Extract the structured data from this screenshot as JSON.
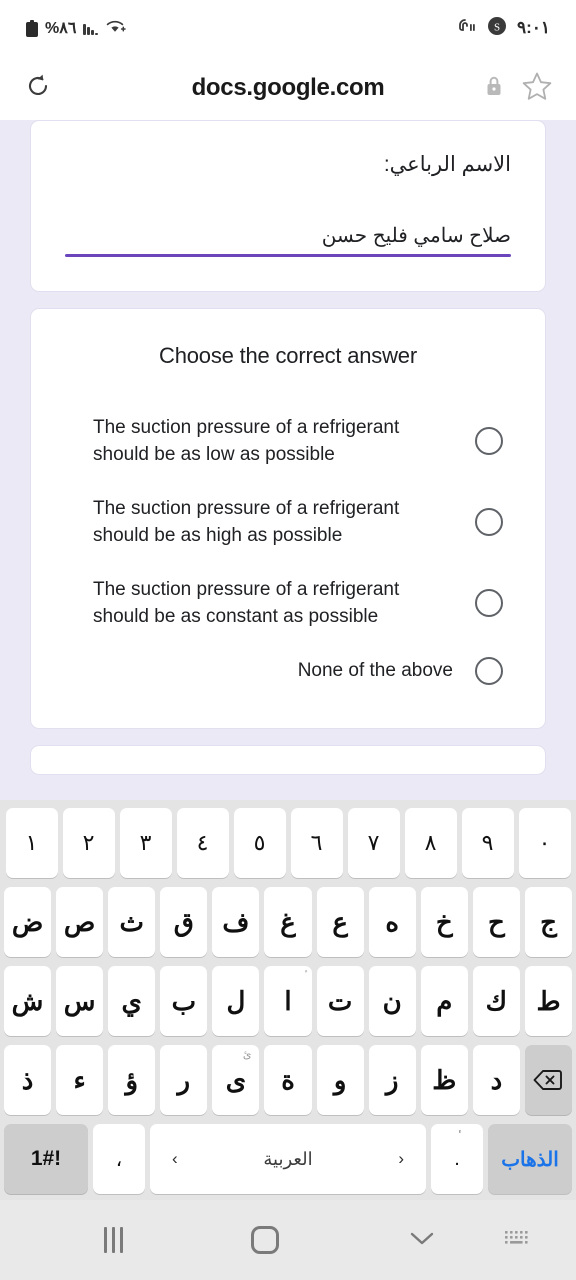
{
  "status_bar": {
    "battery_percent": "%٨٦",
    "battery_icon": "battery-icon",
    "signal_icon": "cellular-signal-icon",
    "wifi_icon": "wifi-icon",
    "vibrate_icon": "vibrate-icon",
    "app_icon": "app-badge-icon",
    "time": "٩:٠١"
  },
  "browser_bar": {
    "reload_icon": "reload-icon",
    "url": "docs.google.com",
    "lock_icon": "lock-icon",
    "bookmark_icon": "star-outline-icon"
  },
  "form": {
    "name_question": {
      "label": "الاسم الرباعي:",
      "answer": "صلاح سامي فليح حسن",
      "underline_color": "#6b45bc"
    },
    "mc_question": {
      "title": "Choose the correct answer",
      "options": [
        "The suction pressure of a refrigerant should be as low as possible",
        "The suction pressure of a refrigerant should be as high as possible",
        "The suction pressure of a refrigerant should be as constant as possible",
        "None of the above"
      ],
      "selected_index": -1
    },
    "error_badge_icon": "error-exclamation-icon"
  },
  "keyboard": {
    "language": "العربية",
    "rows": {
      "numbers": [
        "١",
        "٢",
        "٣",
        "٤",
        "٥",
        "٦",
        "٧",
        "٨",
        "٩",
        "٠"
      ],
      "row1": [
        "ض",
        "ص",
        "ث",
        "ق",
        "ف",
        "غ",
        "ع",
        "ه",
        "خ",
        "ح",
        "ج"
      ],
      "row2": [
        "ش",
        "س",
        "ي",
        "ب",
        "ل",
        "ا",
        "ت",
        "ن",
        "م",
        "ك",
        "ط"
      ],
      "row2_sup_index": 5,
      "row2_sup": "ٔ",
      "row3": [
        "ذ",
        "ء",
        "ؤ",
        "ر",
        "ى",
        "ة",
        "و",
        "ز",
        "ظ",
        "د"
      ],
      "row3_sup_index": 4,
      "row3_sup": "ئ"
    },
    "backspace_icon": "backspace-icon",
    "symbols_key": "1#!",
    "comma_key": "،",
    "period_key": ".",
    "period_sup": "ٔ",
    "arrow_prev": "‹",
    "arrow_next": "›",
    "go_key": "الذهاب",
    "go_key_color": "#1a73e8"
  },
  "nav_bar": {
    "recents_icon": "recents-icon",
    "home_icon": "home-icon",
    "hide_keyboard_icon": "chevron-down-icon",
    "switch_keyboard_icon": "keyboard-switch-icon"
  }
}
